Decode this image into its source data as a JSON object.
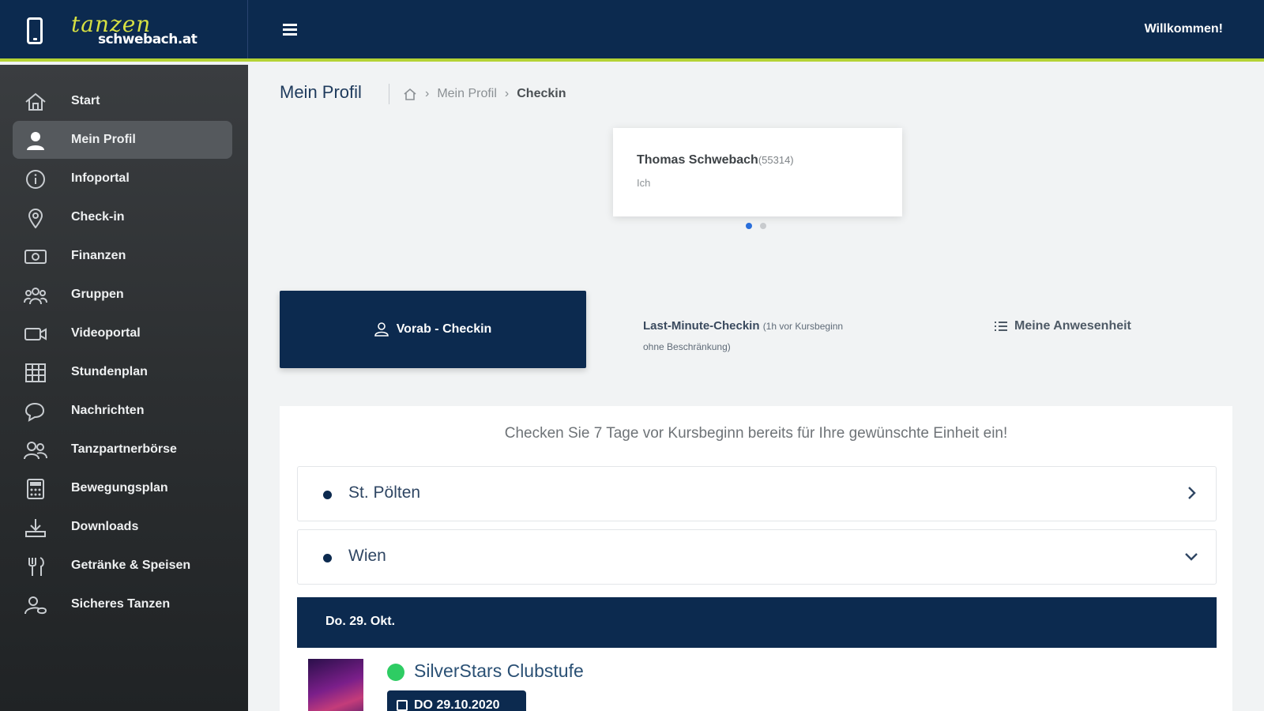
{
  "header": {
    "logo_script": "tanzen",
    "logo_word": "schwebach.at",
    "welcome": "Willkommen!"
  },
  "sidebar": {
    "items": [
      {
        "label": "Start",
        "icon": "home-icon"
      },
      {
        "label": "Mein Profil",
        "icon": "user-icon",
        "active": true
      },
      {
        "label": "Infoportal",
        "icon": "info-icon"
      },
      {
        "label": "Check-in",
        "icon": "location-pin-icon"
      },
      {
        "label": "Finanzen",
        "icon": "money-icon"
      },
      {
        "label": "Gruppen",
        "icon": "group-icon"
      },
      {
        "label": "Videoportal",
        "icon": "video-icon"
      },
      {
        "label": "Stundenplan",
        "icon": "grid-icon"
      },
      {
        "label": "Nachrichten",
        "icon": "chat-icon"
      },
      {
        "label": "Tanzpartnerbörse",
        "icon": "partners-icon"
      },
      {
        "label": "Bewegungsplan",
        "icon": "calculator-icon"
      },
      {
        "label": "Downloads",
        "icon": "download-icon"
      },
      {
        "label": "Getränke & Speisen",
        "icon": "cutlery-icon"
      },
      {
        "label": "Sicheres Tanzen",
        "icon": "safe-user-icon"
      }
    ]
  },
  "main": {
    "page_title": "Mein Profil",
    "breadcrumb": [
      "Mein Profil",
      "Checkin"
    ],
    "profile": {
      "name": "Thomas Schwebach",
      "id": "(55314)",
      "relation": "Ich"
    },
    "carousel": {
      "count": 2,
      "active_index": 0
    },
    "tabs": {
      "vorab": "Vorab - Checkin",
      "last_minute": "Last-Minute-Checkin",
      "last_minute_note": "(1h vor Kursbeginn ohne Beschränkung)",
      "anwesenheit": "Meine Anwesenheit"
    },
    "info_text": "Checken Sie 7 Tage vor Kursbeginn bereits für Ihre gewünschte Einheit ein!",
    "locations": [
      {
        "label": "St. Pölten",
        "state": "collapsed"
      },
      {
        "label": "Wien",
        "state": "expanded"
      }
    ],
    "date_header": "Do. 29. Okt.",
    "event": {
      "title": "SilverStars Clubstufe",
      "date": "DO 29.10.2020",
      "status_color": "#2ecc63"
    }
  },
  "colors": {
    "navy": "#0c2a4f",
    "accent": "#b5d334"
  }
}
